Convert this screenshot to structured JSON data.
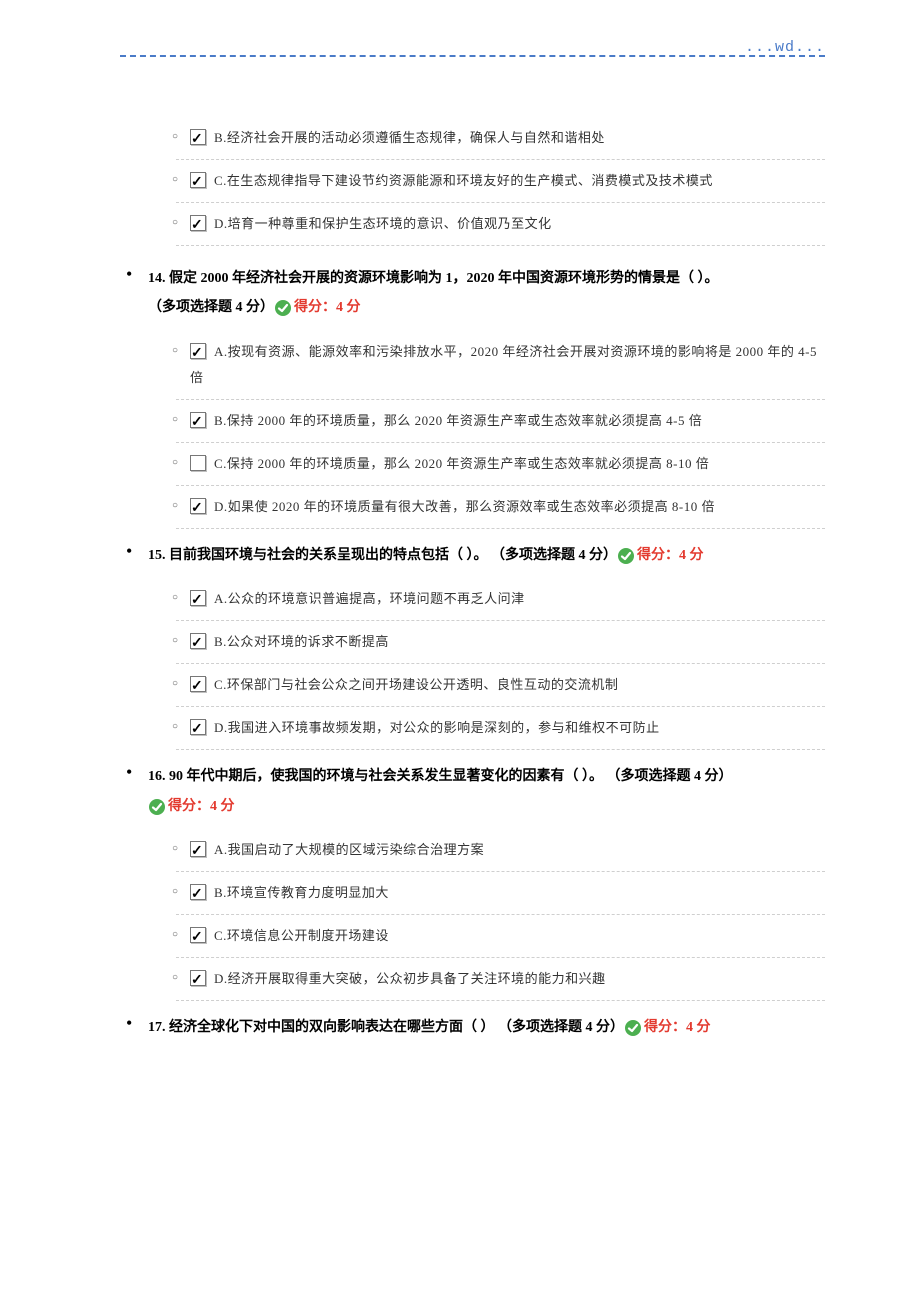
{
  "header": {
    "wd": "...wd..."
  },
  "score_label": "得分：4 分",
  "question_type_label": "（多项选择题 4 分）",
  "frag_options": [
    {
      "checked": true,
      "text": "B.经济社会开展的活动必须遵循生态规律，确保人与自然和谐相处"
    },
    {
      "checked": true,
      "text": "C.在生态规律指导下建设节约资源能源和环境友好的生产模式、消费模式及技术模式"
    },
    {
      "checked": true,
      "text": "D.培育一种尊重和保护生态环境的意识、价值观乃至文化"
    }
  ],
  "questions": [
    {
      "num": "14",
      "text": "14. 假定 2000 年经济社会开展的资源环境影响为 1，2020 年中国资源环境形势的情景是（ ）。",
      "options": [
        {
          "checked": true,
          "text": "A.按现有资源、能源效率和污染排放水平，2020 年经济社会开展对资源环境的影响将是 2000 年的 4-5 倍"
        },
        {
          "checked": true,
          "text": "B.保持 2000 年的环境质量，那么 2020 年资源生产率或生态效率就必须提高 4-5 倍"
        },
        {
          "checked": false,
          "text": "C.保持 2000 年的环境质量，那么 2020 年资源生产率或生态效率就必须提高 8-10 倍"
        },
        {
          "checked": true,
          "text": "D.如果使 2020 年的环境质量有很大改善，那么资源效率或生态效率必须提高 8-10 倍"
        }
      ]
    },
    {
      "num": "15",
      "text": "15. 目前我国环境与社会的关系呈现出的特点包括（ ）。",
      "inline_type": true,
      "options": [
        {
          "checked": true,
          "text": "A.公众的环境意识普遍提高，环境问题不再乏人问津"
        },
        {
          "checked": true,
          "text": "B.公众对环境的诉求不断提高"
        },
        {
          "checked": true,
          "text": "C.环保部门与社会公众之间开场建设公开透明、良性互动的交流机制"
        },
        {
          "checked": true,
          "text": "D.我国进入环境事故频发期，对公众的影响是深刻的，参与和维权不可防止"
        }
      ]
    },
    {
      "num": "16",
      "text": "16. 90 年代中期后，使我国的环境与社会关系发生显著变化的因素有（ ）。",
      "inline_type": true,
      "score_newline": true,
      "options": [
        {
          "checked": true,
          "text": "A.我国启动了大规模的区域污染综合治理方案"
        },
        {
          "checked": true,
          "text": "B.环境宣传教育力度明显加大"
        },
        {
          "checked": true,
          "text": "C.环境信息公开制度开场建设"
        },
        {
          "checked": true,
          "text": "D.经济开展取得重大突破，公众初步具备了关注环境的能力和兴趣"
        }
      ]
    },
    {
      "num": "17",
      "text": "17. 经济全球化下对中国的双向影响表达在哪些方面（ ）",
      "inline_type": true,
      "no_options": true
    }
  ]
}
